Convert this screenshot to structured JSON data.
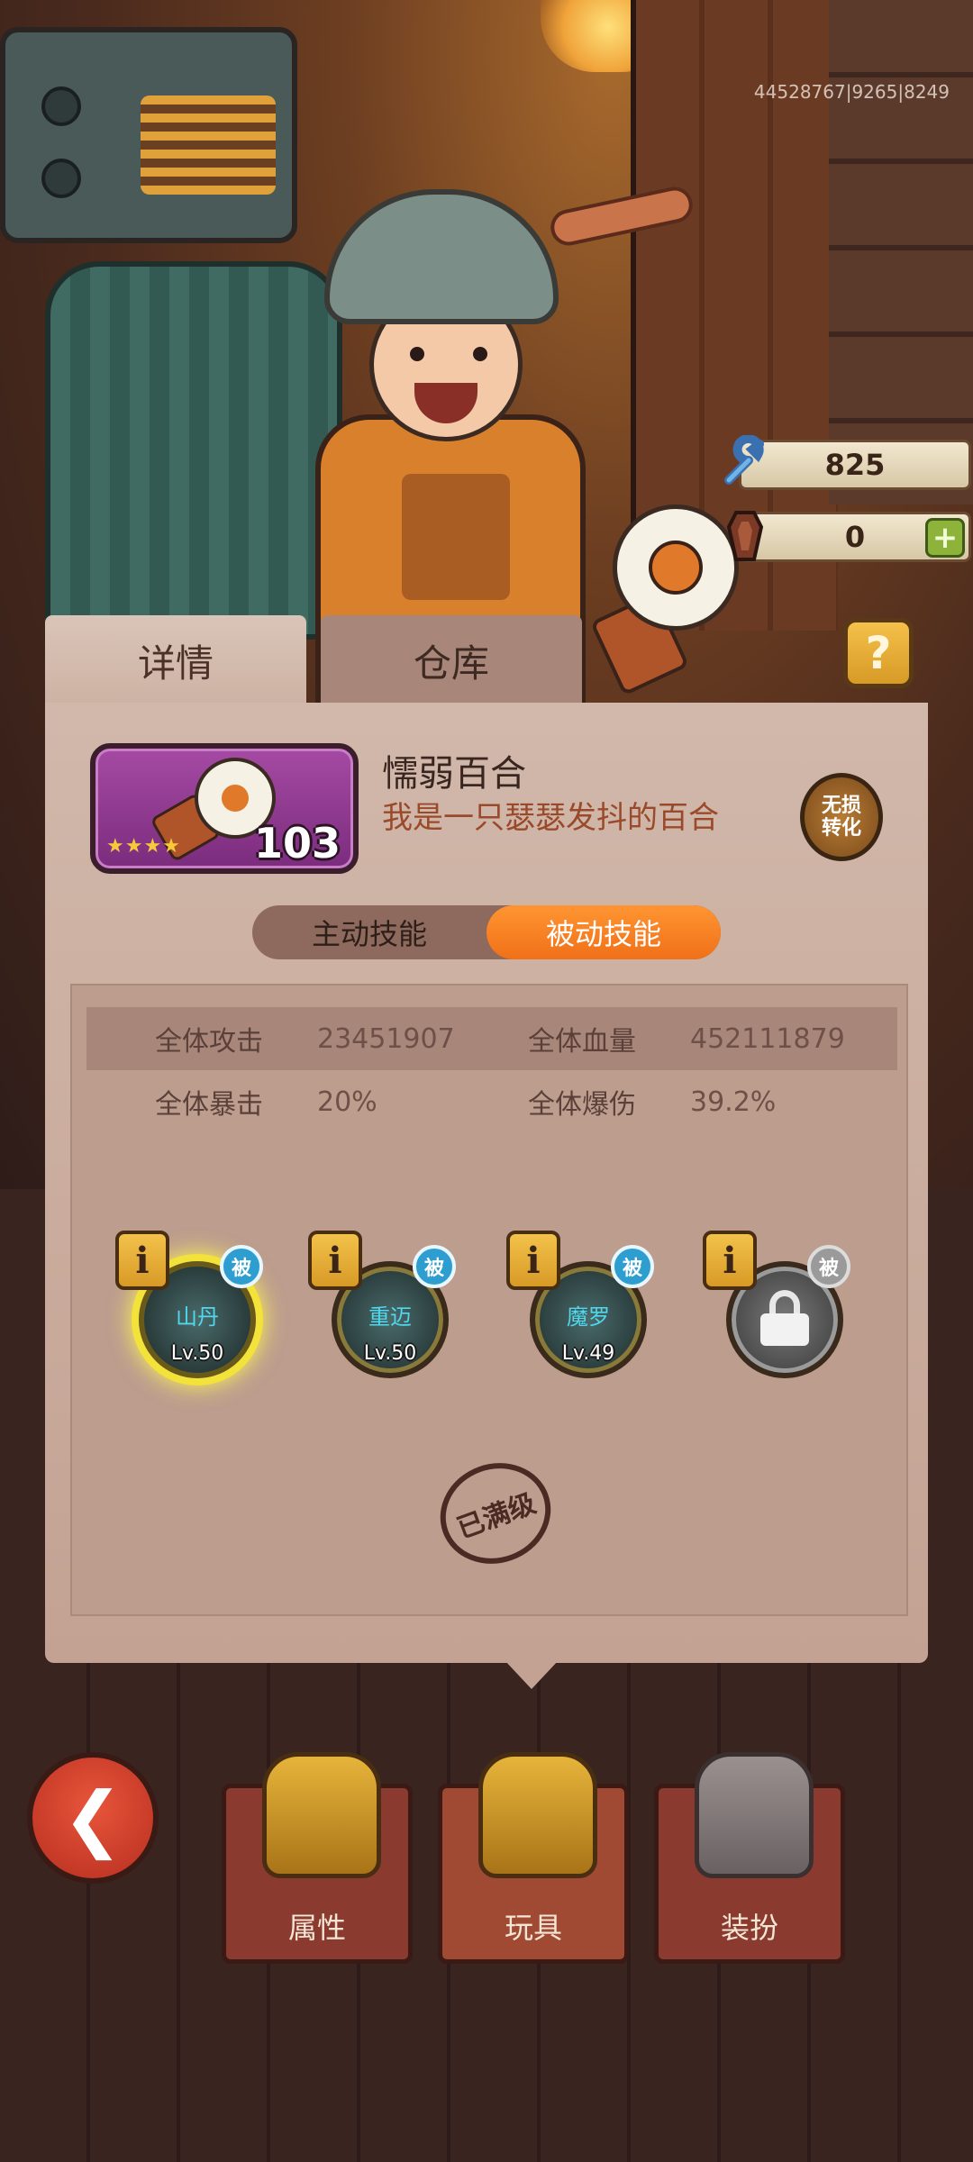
{
  "hud": {
    "server_id": "44528767|9265|8249",
    "currency_wrench": "825",
    "currency_coffin": "0"
  },
  "tabs": {
    "details": "详情",
    "warehouse": "仓库"
  },
  "help_label": "?",
  "item": {
    "name": "懦弱百合",
    "description": "我是一只瑟瑟发抖的百合",
    "level": "103",
    "stars": "★★★★",
    "convert_label_line1": "无损",
    "convert_label_line2": "转化"
  },
  "skill_toggle": {
    "active": "主动技能",
    "passive": "被动技能",
    "selected": "passive"
  },
  "stats": [
    {
      "label": "全体攻击",
      "value": "23451907"
    },
    {
      "label": "全体血量",
      "value": "452111879"
    },
    {
      "label": "全体暴击",
      "value": "20%"
    },
    {
      "label": "全体爆伤",
      "value": "39.2%"
    }
  ],
  "skills": [
    {
      "name": "山丹",
      "level": "Lv.50",
      "badge": "被",
      "info": "i",
      "selected": true,
      "locked": false
    },
    {
      "name": "重迈",
      "level": "Lv.50",
      "badge": "被",
      "info": "i",
      "selected": false,
      "locked": false
    },
    {
      "name": "魔罗",
      "level": "Lv.49",
      "badge": "被",
      "info": "i",
      "selected": false,
      "locked": false
    },
    {
      "name": "",
      "level": "",
      "badge": "被",
      "info": "i",
      "selected": false,
      "locked": true
    }
  ],
  "max_level_stamp": "已满级",
  "bottom_nav": {
    "attributes": "属性",
    "toys": "玩具",
    "outfit": "装扮",
    "active": "toys"
  },
  "icons": {
    "back": "back-arrow-icon",
    "wrench": "wrench-icon",
    "coffin": "coffin-icon",
    "plus": "plus-icon",
    "lock": "lock-icon"
  },
  "colors": {
    "accent_orange": "#f07018",
    "panel": "#cdb2a3",
    "item_rarity_purple": "#a54aa4",
    "passive_badge_blue": "#2e9ed0",
    "skill_name_cyan": "#4fd8ee"
  }
}
